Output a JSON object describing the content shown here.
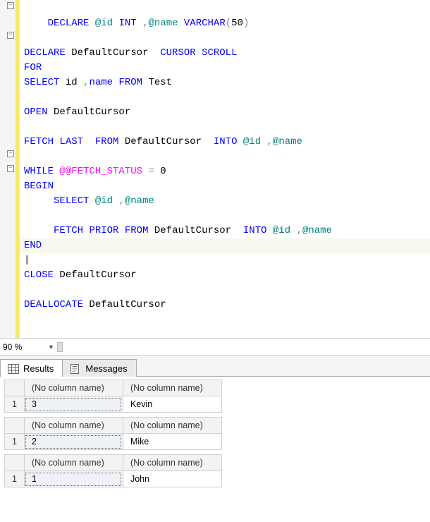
{
  "code": {
    "l1": "DECLARE @id INT ,@name VARCHAR(50)",
    "l3": "DECLARE DefaultCursor  CURSOR SCROLL",
    "l4": "FOR",
    "l5": "SELECT id ,name FROM Test",
    "l7": "OPEN DefaultCursor",
    "l9": "FETCH LAST  FROM DefaultCursor  INTO @id ,@name",
    "l11": "WHILE @@FETCH_STATUS = 0",
    "l12": "BEGIN",
    "l13": "     SELECT @id ,@name",
    "l15": "     FETCH PRIOR FROM DefaultCursor  INTO @id ,@name",
    "l16": "END",
    "l18": "CLOSE DefaultCursor",
    "l20": "DEALLOCATE DefaultCursor"
  },
  "zoom": {
    "value": "90 %"
  },
  "tabs": {
    "results": "Results",
    "messages": "Messages"
  },
  "grid": {
    "noColName": "(No column name)",
    "rows": [
      {
        "n": "1",
        "c1": "3",
        "c2": "Kevin"
      },
      {
        "n": "1",
        "c1": "2",
        "c2": "Mike"
      },
      {
        "n": "1",
        "c1": "1",
        "c2": "John"
      }
    ]
  },
  "chart_data": {
    "type": "table",
    "title": "SQL cursor iteration results (reverse order)",
    "columns": [
      "(No column name)",
      "(No column name)"
    ],
    "result_sets": [
      {
        "rows": [
          [
            "3",
            "Kevin"
          ]
        ]
      },
      {
        "rows": [
          [
            "2",
            "Mike"
          ]
        ]
      },
      {
        "rows": [
          [
            "1",
            "John"
          ]
        ]
      }
    ]
  }
}
